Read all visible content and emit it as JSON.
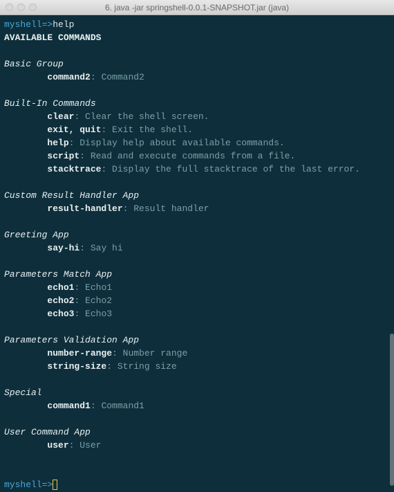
{
  "titlebar": {
    "title": "6. java -jar springshell-0.0.1-SNAPSHOT.jar (java)"
  },
  "prompt": "myshell=>",
  "input_command": "help",
  "heading": "AVAILABLE COMMANDS",
  "groups": [
    {
      "name": "Basic Group",
      "commands": [
        {
          "cmd": "command2",
          "desc": "Command2"
        }
      ]
    },
    {
      "name": "Built-In Commands",
      "commands": [
        {
          "cmd": "clear",
          "desc": "Clear the shell screen."
        },
        {
          "cmd": "exit, quit",
          "desc": "Exit the shell."
        },
        {
          "cmd": "help",
          "desc": "Display help about available commands."
        },
        {
          "cmd": "script",
          "desc": "Read and execute commands from a file."
        },
        {
          "cmd": "stacktrace",
          "desc": "Display the full stacktrace of the last error."
        }
      ]
    },
    {
      "name": "Custom Result Handler App",
      "commands": [
        {
          "cmd": "result-handler",
          "desc": "Result handler"
        }
      ]
    },
    {
      "name": "Greeting App",
      "commands": [
        {
          "cmd": "say-hi",
          "desc": "Say hi"
        }
      ]
    },
    {
      "name": "Parameters Match App",
      "commands": [
        {
          "cmd": "echo1",
          "desc": "Echo1"
        },
        {
          "cmd": "echo2",
          "desc": "Echo2"
        },
        {
          "cmd": "echo3",
          "desc": "Echo3"
        }
      ]
    },
    {
      "name": "Parameters Validation App",
      "commands": [
        {
          "cmd": "number-range",
          "desc": "Number range"
        },
        {
          "cmd": "string-size",
          "desc": "String size"
        }
      ]
    },
    {
      "name": "Special",
      "commands": [
        {
          "cmd": "command1",
          "desc": "Command1"
        }
      ]
    },
    {
      "name": "User Command App",
      "commands": [
        {
          "cmd": "user",
          "desc": "User"
        }
      ]
    }
  ]
}
